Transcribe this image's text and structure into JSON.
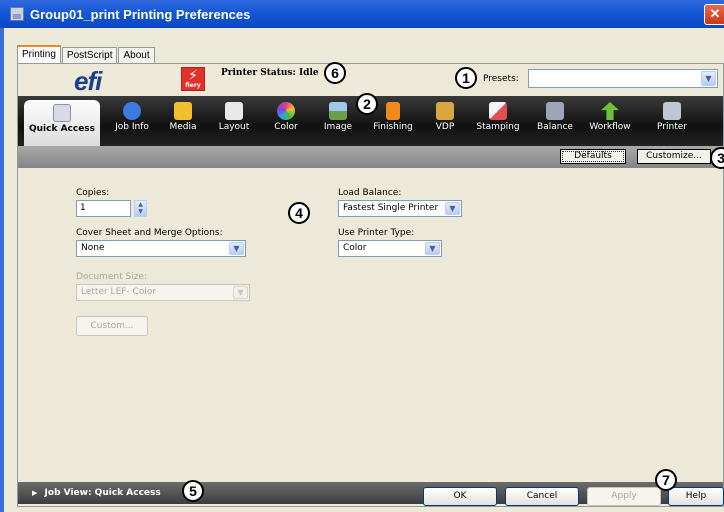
{
  "window": {
    "title": "Group01_print Printing Preferences",
    "close_glyph": "✕"
  },
  "tabs": [
    "Printing",
    "PostScript",
    "About"
  ],
  "brand": {
    "efi_logo_text": "efi",
    "fiery_logo_text": "fiery",
    "printer_status": "Printer Status: Idle"
  },
  "presets": {
    "label": "Presets:",
    "value": ""
  },
  "toolbar": {
    "items": [
      {
        "label": "Quick Access",
        "icon": "quick-access-icon",
        "color": "#d8dbe6"
      },
      {
        "label": "Job Info",
        "icon": "info-icon",
        "color": "#3b7be0"
      },
      {
        "label": "Media",
        "icon": "media-icon",
        "color": "#f0c030"
      },
      {
        "label": "Layout",
        "icon": "layout-icon",
        "color": "#e8e8e8"
      },
      {
        "label": "Color",
        "icon": "color-wheel-icon",
        "color": "#e04080"
      },
      {
        "label": "Image",
        "icon": "image-icon",
        "color": "#6aa04a"
      },
      {
        "label": "Finishing",
        "icon": "finishing-icon",
        "color": "#f08a1c"
      },
      {
        "label": "VDP",
        "icon": "vdp-icon",
        "color": "#d9a640"
      },
      {
        "label": "Stamping",
        "icon": "stamping-icon",
        "color": "#e05050"
      },
      {
        "label": "Balance",
        "icon": "balance-icon",
        "color": "#9aa6b8"
      },
      {
        "label": "Workflow",
        "icon": "workflow-icon",
        "color": "#6cc03a"
      },
      {
        "label": "Printer",
        "icon": "printer-icon",
        "color": "#c0c6d2"
      }
    ]
  },
  "subbar": {
    "defaults_label": "Defaults",
    "customize_label": "Customize..."
  },
  "form": {
    "copies_label": "Copies:",
    "copies_value": "1",
    "cover_label": "Cover Sheet and Merge Options:",
    "cover_value": "None",
    "docsize_label": "Document Size:",
    "docsize_value": "Letter LEF- Color",
    "custom_label": "Custom...",
    "load_balance_label": "Load Balance:",
    "load_balance_value": "Fastest Single Printer",
    "printer_type_label": "Use Printer Type:",
    "printer_type_value": "Color"
  },
  "jobview": {
    "label": "Job View: Quick Access",
    "arrow": "▶"
  },
  "buttons": {
    "ok": "OK",
    "cancel": "Cancel",
    "apply": "Apply",
    "help": "Help"
  },
  "callouts": [
    "1",
    "2",
    "3",
    "4",
    "5",
    "6",
    "7"
  ]
}
